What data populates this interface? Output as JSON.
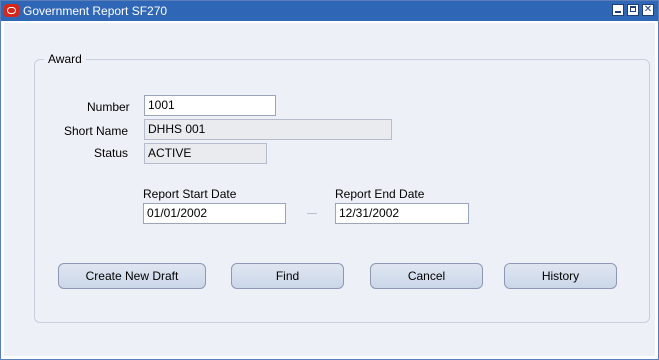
{
  "window": {
    "title": "Government Report SF270",
    "controls": {
      "minimize_icon": "minimize-icon",
      "maximize_icon": "maximize-icon",
      "close_glyph": "✕"
    }
  },
  "award": {
    "group_label": "Award",
    "number_label": "Number",
    "number_value": "1001",
    "short_name_label": "Short Name",
    "short_name_value": "DHHS 001",
    "status_label": "Status",
    "status_value": "ACTIVE",
    "start_date_label": "Report Start Date",
    "start_date_value": "01/01/2002",
    "end_date_label": "Report End Date",
    "end_date_value": "12/31/2002"
  },
  "buttons": {
    "create_new_draft": "Create New Draft",
    "find": "Find",
    "cancel": "Cancel",
    "history": "History"
  },
  "colors": {
    "titlebar": "#2f66b6",
    "client_bg": "#eef0f7",
    "logo": "#d6271b"
  }
}
